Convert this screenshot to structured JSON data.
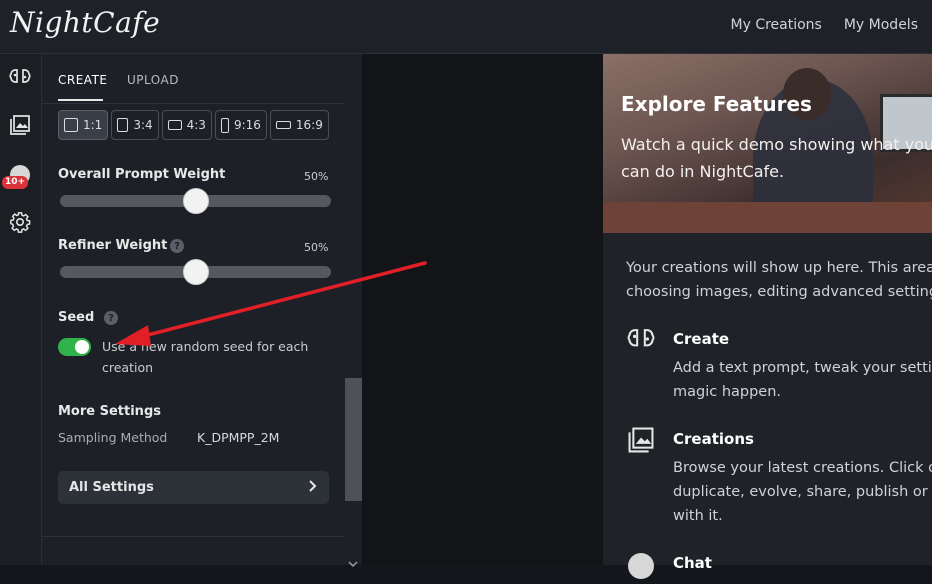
{
  "app": {
    "logo_text": "NightCafe"
  },
  "topnav": {
    "my_creations": "My Creations",
    "my_models": "My Models"
  },
  "rail": {
    "badge": "10+",
    "icons": [
      "brain-icon",
      "gallery-icon",
      "avatar",
      "gear-icon"
    ]
  },
  "tabs": {
    "create": "CREATE",
    "upload": "UPLOAD"
  },
  "ratios": [
    {
      "label": "1:1",
      "active": true
    },
    {
      "label": "3:4",
      "active": false
    },
    {
      "label": "4:3",
      "active": false
    },
    {
      "label": "9:16",
      "active": false
    },
    {
      "label": "16:9",
      "active": false
    }
  ],
  "prompt_weight": {
    "label": "Overall Prompt Weight",
    "value_text": "50%",
    "value": 0.5
  },
  "refiner_weight": {
    "label": "Refiner Weight",
    "help": "?",
    "value_text": "50%",
    "value": 0.5
  },
  "seed": {
    "label": "Seed",
    "help": "?",
    "toggle_text": "Use a new random seed for each creation",
    "toggle_on": true
  },
  "more_settings": {
    "label": "More Settings",
    "sampling_label": "Sampling Method",
    "sampling_value": "K_DPMPP_2M"
  },
  "all_settings": {
    "label": "All Settings"
  },
  "explore": {
    "title": "Explore Features",
    "subtitle_line1": "Watch a quick demo showing what you",
    "subtitle_line2": "can do in NightCafe.",
    "intro_line1": "Your creations will show up here. This area c",
    "intro_line2": "choosing images, editing advanced settings"
  },
  "features": [
    {
      "title": "Create",
      "desc_line1": "Add a text prompt, tweak your settin",
      "desc_line2": "magic happen.",
      "desc_line3": ""
    },
    {
      "title": "Creations",
      "desc_line1": "Browse your latest creations. Click on",
      "desc_line2": "duplicate, evolve, share, publish or do",
      "desc_line3": "with it."
    },
    {
      "title": "Chat",
      "desc_line1": "",
      "desc_line2": "",
      "desc_line3": ""
    }
  ],
  "colors": {
    "toggle_on": "#2fb34a",
    "badge": "#d9323a",
    "arrow": "#e21f26"
  }
}
